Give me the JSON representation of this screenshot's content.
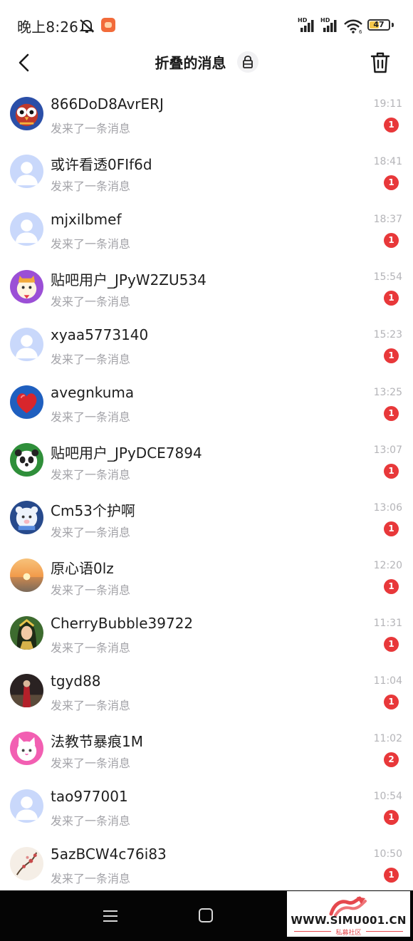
{
  "status_bar": {
    "time": "晚上8:26",
    "signal_label_1": "HD",
    "signal_label_2": "HD",
    "wifi_label": "6",
    "battery": "47",
    "battery_level": 0.47
  },
  "header": {
    "title": "折叠的消息"
  },
  "conversations": [
    {
      "name": "866DoD8AvrERJ",
      "preview": "发来了一条消息",
      "time": "19:11",
      "unread": "1",
      "avatar": "owl"
    },
    {
      "name": "或许看透0FIf6d",
      "preview": "发来了一条消息",
      "time": "18:41",
      "unread": "1",
      "avatar": "default"
    },
    {
      "name": "mjxilbmef",
      "preview": "发来了一条消息",
      "time": "18:37",
      "unread": "1",
      "avatar": "default"
    },
    {
      "name": "贴吧用户_JPyW2ZU534",
      "preview": "发来了一条消息",
      "time": "15:54",
      "unread": "1",
      "avatar": "cat"
    },
    {
      "name": "xyaa5773140",
      "preview": "发来了一条消息",
      "time": "15:23",
      "unread": "1",
      "avatar": "default"
    },
    {
      "name": "avegnkuma",
      "preview": "发来了一条消息",
      "time": "13:25",
      "unread": "1",
      "avatar": "heart"
    },
    {
      "name": "贴吧用户_JPyDCE7894",
      "preview": "发来了一条消息",
      "time": "13:07",
      "unread": "1",
      "avatar": "panda"
    },
    {
      "name": "Cm53个护啊",
      "preview": "发来了一条消息",
      "time": "13:06",
      "unread": "1",
      "avatar": "bear"
    },
    {
      "name": "原心语0lz",
      "preview": "发来了一条消息",
      "time": "12:20",
      "unread": "1",
      "avatar": "sunset"
    },
    {
      "name": "CherryBubble39722",
      "preview": "发来了一条消息",
      "time": "11:31",
      "unread": "1",
      "avatar": "girl"
    },
    {
      "name": "tgyd88",
      "preview": "发来了一条消息",
      "time": "11:04",
      "unread": "1",
      "avatar": "photo"
    },
    {
      "name": "法教节暴痕1M",
      "preview": "发来了一条消息",
      "time": "11:02",
      "unread": "2",
      "avatar": "pinkcat"
    },
    {
      "name": "tao977001",
      "preview": "发来了一条消息",
      "time": "10:54",
      "unread": "1",
      "avatar": "default"
    },
    {
      "name": "5azBCW4c76i83",
      "preview": "发来了一条消息",
      "time": "10:50",
      "unread": "1",
      "avatar": "blossom"
    }
  ],
  "watermark": {
    "url": "WWW.SIMU001.CN",
    "subtitle": "私募社区"
  },
  "colors": {
    "badge": "#e8383a",
    "default_avatar": "#c9d8fb",
    "time_text": "#b4b4b8",
    "preview_text": "#a3a3a8"
  }
}
